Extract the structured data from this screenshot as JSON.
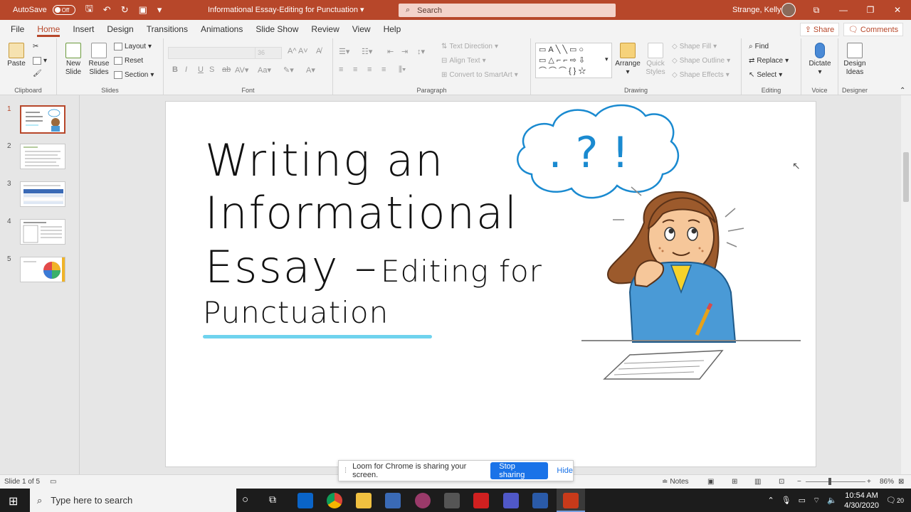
{
  "titlebar": {
    "autosave_label": "AutoSave",
    "autosave_state": "Off",
    "doc_title": "Informational Essay-Editing for Punctuation",
    "search_placeholder": "Search",
    "user_name": "Strange, Kelly"
  },
  "menu": {
    "items": [
      "File",
      "Home",
      "Insert",
      "Design",
      "Transitions",
      "Animations",
      "Slide Show",
      "Review",
      "View",
      "Help"
    ],
    "active": "Home",
    "share_label": "Share",
    "comments_label": "Comments"
  },
  "ribbon": {
    "clipboard": {
      "label": "Clipboard",
      "paste": "Paste"
    },
    "slides": {
      "label": "Slides",
      "new_slide": "New Slide",
      "reuse_slides": "Reuse Slides",
      "layout": "Layout",
      "reset": "Reset",
      "section": "Section"
    },
    "font": {
      "label": "Font",
      "size": "36"
    },
    "paragraph": {
      "label": "Paragraph",
      "text_direction": "Text Direction",
      "align_text": "Align Text",
      "convert_smartart": "Convert to SmartArt"
    },
    "drawing": {
      "label": "Drawing",
      "arrange": "Arrange",
      "quick_styles": "Quick Styles",
      "shape_fill": "Shape Fill",
      "shape_outline": "Shape Outline",
      "shape_effects": "Shape Effects"
    },
    "editing": {
      "label": "Editing",
      "find": "Find",
      "replace": "Replace",
      "select": "Select"
    },
    "voice": {
      "label": "Voice",
      "dictate": "Dictate"
    },
    "designer": {
      "label": "Designer",
      "design_ideas": "Design Ideas"
    }
  },
  "thumbnails": [
    "1",
    "2",
    "3",
    "4",
    "5"
  ],
  "selected_slide": "1",
  "slide": {
    "line1": "Writing an",
    "line2": "Informational",
    "line3a": "Essay –",
    "line3b": "Editing for",
    "line4": "Punctuation",
    "cloud_text": ". ? !",
    "underline_color": "#6fd3ee"
  },
  "status": {
    "slide_of": "Slide 1 of 5",
    "notes": "Notes",
    "zoom": "86%"
  },
  "loom": {
    "message": "Loom for Chrome is sharing your screen.",
    "stop": "Stop sharing",
    "hide": "Hide"
  },
  "taskbar": {
    "search_placeholder": "Type here to search",
    "time": "10:54 AM",
    "date": "4/30/2020",
    "notif_count": "20"
  }
}
